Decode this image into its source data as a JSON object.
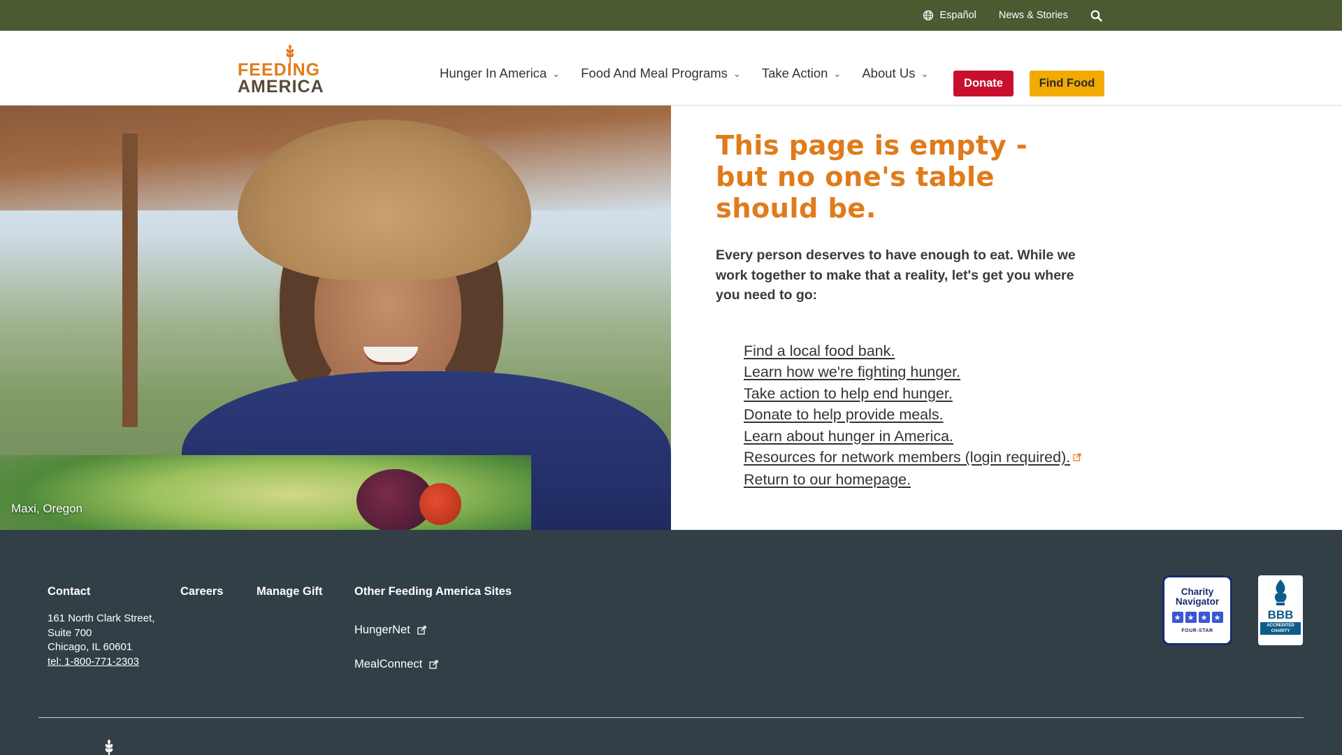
{
  "utility": {
    "language": "Español",
    "news": "News & Stories"
  },
  "logo": {
    "line1": "FEEDING",
    "line2": "AMERICA"
  },
  "nav": {
    "items": [
      {
        "label": "Hunger In America"
      },
      {
        "label": "Food And Meal Programs"
      },
      {
        "label": "Take Action"
      },
      {
        "label": "About Us"
      }
    ],
    "donate": "Donate",
    "find_food": "Find Food"
  },
  "hero": {
    "caption": "Maxi, Oregon"
  },
  "content": {
    "headline": "This page is empty - but no one's table should be.",
    "intro": "Every person deserves to have enough to eat. While we work together to make that a reality, let's get you where you need to go:",
    "links": [
      {
        "label": "Find a local food bank."
      },
      {
        "label": "Learn how we're fighting hunger."
      },
      {
        "label": "Take action to help end hunger."
      },
      {
        "label": "Donate to help provide meals."
      },
      {
        "label": "Learn about hunger in America."
      },
      {
        "label": "Resources for network members (login required).",
        "external": true
      },
      {
        "label": "Return to our homepage."
      }
    ]
  },
  "footer": {
    "contact_heading": "Contact",
    "address_line1": "161 North Clark Street,",
    "address_line2": "Suite 700",
    "address_line3": "Chicago, IL 60601",
    "phone": "tel: 1-800-771-2303",
    "careers": "Careers",
    "manage_gift": "Manage Gift",
    "other_sites_heading": "Other Feeding America Sites",
    "sites": [
      "HungerNet",
      "MealConnect"
    ],
    "charity_navigator": {
      "title_line1": "Charity",
      "title_line2": "Navigator",
      "rating": "FOUR-STAR"
    },
    "bbb": {
      "title": "BBB",
      "subtitle_line1": "ACCREDITED",
      "subtitle_line2": "CHARITY"
    }
  },
  "colors": {
    "utility_bar": "#4b5a31",
    "headline_orange": "#e07b1a",
    "donate_red": "#c8102e",
    "find_food_yellow": "#f2a900",
    "footer_bg": "#333f47"
  },
  "icons": {
    "language": "globe-icon",
    "search": "search-icon",
    "nav_chevron": "chevron-down-icon",
    "external": "external-link-icon"
  }
}
